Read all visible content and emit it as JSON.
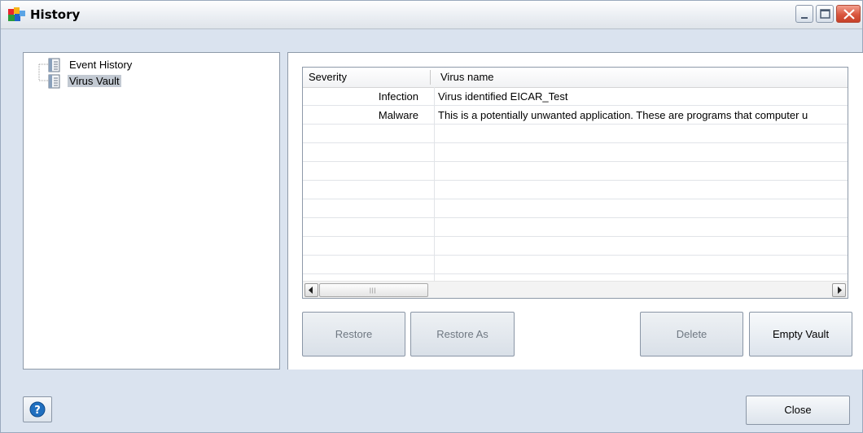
{
  "window": {
    "title": "History",
    "controls": [
      "minimize",
      "maximize",
      "close"
    ]
  },
  "tree": {
    "items": [
      {
        "label": "Event History",
        "icon": "document-list-icon",
        "selected": false
      },
      {
        "label": "Virus Vault",
        "icon": "document-list-icon",
        "selected": true
      }
    ]
  },
  "table": {
    "columns": [
      "Severity",
      "Virus name"
    ],
    "rows": [
      {
        "severity": "Infection",
        "name": "Virus identified EICAR_Test"
      },
      {
        "severity": "Malware",
        "name": "This is a potentially unwanted application. These are programs that computer u"
      }
    ]
  },
  "buttons": {
    "restore": "Restore",
    "restore_as": "Restore As",
    "delete": "Delete",
    "empty_vault": "Empty Vault",
    "close": "Close"
  },
  "colors": {
    "window_bg": "#dae3ef",
    "selection": "#c2c9d2",
    "close_button": "#d9563f",
    "help_icon": "#1f6fbf"
  }
}
